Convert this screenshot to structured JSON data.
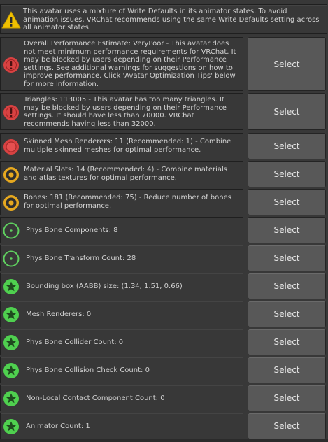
{
  "banner": {
    "icon": "warning-icon",
    "text": "This avatar uses a mixture of Write Defaults in its animator states. To avoid animation issues, VRChat recommends using the same Write Defaults setting across all animator states."
  },
  "select_label": "Select",
  "colors": {
    "error": "#d84242",
    "warning": "#e6a81f",
    "info": "#5fd05f",
    "ok": "#4fd04f"
  },
  "rows": [
    {
      "icon": "error-icon",
      "text": "Overall Performance Estimate: VeryPoor - This avatar does not meet minimum performance requirements for VRChat. It may be blocked by users depending on their Performance settings. See additional warnings for suggestions on how to improve performance. Click 'Avatar Optimization Tips' below for more information."
    },
    {
      "icon": "error-icon",
      "text": "Triangles: 113005 - This avatar has too many triangles. It may be blocked by users depending on their Performance settings. It should have less than 70000. VRChat recommends having less than 32000."
    },
    {
      "icon": "red-circle-icon",
      "text": "Skinned Mesh Renderers: 11 (Recommended: 1) - Combine multiple skinned meshes for optimal performance."
    },
    {
      "icon": "orange-circle-icon",
      "text": "Material Slots: 14 (Recommended: 4) - Combine materials and atlas textures for optimal performance."
    },
    {
      "icon": "orange-circle-icon",
      "text": "Bones: 181 (Recommended: 75) - Reduce number of bones for optimal performance."
    },
    {
      "icon": "green-ring-icon",
      "text": "Phys Bone Components: 8"
    },
    {
      "icon": "green-ring-icon",
      "text": "Phys Bone Transform Count: 28"
    },
    {
      "icon": "green-star-icon",
      "text": "Bounding box (AABB) size: (1.34, 1.51, 0.66)"
    },
    {
      "icon": "green-star-icon",
      "text": "Mesh Renderers: 0"
    },
    {
      "icon": "green-star-icon",
      "text": "Phys Bone Collider Count: 0"
    },
    {
      "icon": "green-star-icon",
      "text": "Phys Bone Collision Check Count: 0"
    },
    {
      "icon": "green-star-icon",
      "text": "Non-Local Contact Component Count: 0"
    },
    {
      "icon": "green-star-icon",
      "text": "Animator Count: 1"
    }
  ]
}
